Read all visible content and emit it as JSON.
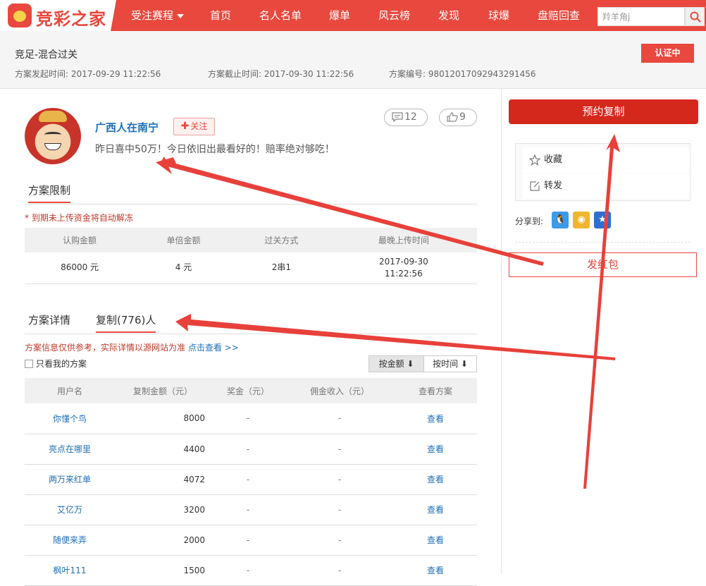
{
  "topnav": {
    "logo_text": "竞彩之家",
    "items": [
      "受注赛程",
      "首页",
      "名人名单",
      "爆单",
      "风云榜",
      "发现",
      "球爆",
      "盘赔回查"
    ],
    "search_placeholder": "羚羊角j"
  },
  "header": {
    "title": "竞足-混合过关",
    "start_time": "方案发起时间: 2017-09-29 11:22:56",
    "end_time": "方案截止时间: 2017-09-30 11:22:56",
    "plan_no": "方案编号: 98012017092943291456",
    "badge": "认证中"
  },
  "profile": {
    "username": "广西人在南宁",
    "follow_label": "关注",
    "comment_count": "12",
    "like_count": "9",
    "bio": "昨日喜中50万！今日依旧出最看好的！赔率绝对够吃！"
  },
  "limits": {
    "tab_label": "方案限制",
    "notice": "* 到期未上传资金将自动解冻",
    "headers": [
      "认购金额",
      "单倍金额",
      "过关方式",
      "最晚上传时间"
    ],
    "row": [
      "86000 元",
      "4 元",
      "2串1",
      "2017-09-30",
      "11:22:56"
    ]
  },
  "copy": {
    "tab_detail": "方案详情",
    "tab_copy": "复制(776)人",
    "info_text": "方案信息仅供参考，实际详情以源网站为准",
    "info_link": "点击查看 >>",
    "checkbox_label": "只看我的方案",
    "sort_amount": "按金额 ⬇",
    "sort_time": "按时间 ⬇",
    "headers": [
      "用户名",
      "复制金额（元）",
      "奖金（元）",
      "佣金收入（元）",
      "查看方案"
    ],
    "rows": [
      {
        "user": "你懂个鸟",
        "amount": "8000",
        "bonus": "-",
        "commission": "-",
        "view": "查看"
      },
      {
        "user": "亮点在哪里",
        "amount": "4400",
        "bonus": "-",
        "commission": "-",
        "view": "查看"
      },
      {
        "user": "两万来红单",
        "amount": "4072",
        "bonus": "-",
        "commission": "-",
        "view": "查看"
      },
      {
        "user": "艾亿万",
        "amount": "3200",
        "bonus": "-",
        "commission": "-",
        "view": "查看"
      },
      {
        "user": "随便来弄",
        "amount": "2000",
        "bonus": "-",
        "commission": "-",
        "view": "查看"
      },
      {
        "user": "枫叶111",
        "amount": "1500",
        "bonus": "-",
        "commission": "-",
        "view": "查看"
      }
    ]
  },
  "sidebar": {
    "reserve_label": "预约复制",
    "collect_label": "收藏",
    "forward_label": "转发",
    "share_label": "分享到:",
    "redpack_label": "发红包"
  },
  "colors": {
    "brand": "#e8483d",
    "link": "#1e6fb8",
    "annotation": "#e8403a"
  }
}
